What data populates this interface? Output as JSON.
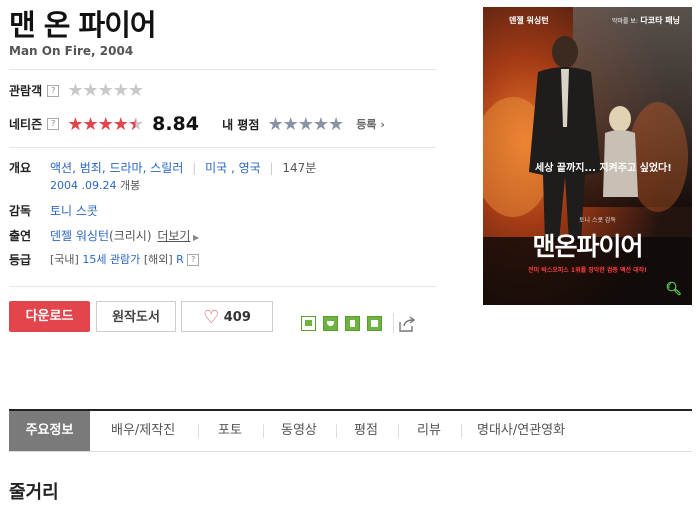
{
  "movie": {
    "title": "맨 온 파이어",
    "original_title": "Man On Fire, 2004"
  },
  "rating": {
    "audience_label": "관람객",
    "netizen_label": "네티즌",
    "netizen_score": "8.84",
    "my_rating_label": "내 평점",
    "register_label": "등록",
    "help_glyph": "?"
  },
  "info": {
    "summary_label": "개요",
    "genres": [
      "액션",
      "범죄",
      "드라마",
      "스릴러"
    ],
    "countries": [
      "미국",
      "영국"
    ],
    "runtime": "147분",
    "release_date": "2004 .09.24",
    "release_suffix": "개봉",
    "director_label": "감독",
    "director": "토니 스콧",
    "cast_label": "출연",
    "cast_name": "덴젤 워싱턴",
    "cast_role": "(크리시)",
    "more_label": "더보기",
    "grade_label": "등급",
    "grade_domestic_prefix": "[국내]",
    "grade_domestic": "15세 관람가",
    "grade_overseas_prefix": "[해외]",
    "grade_overseas": "R"
  },
  "actions": {
    "download_label": "다운로드",
    "book_label": "원작도서",
    "like_count": "409"
  },
  "poster": {
    "actor_left": "덴젤 워싱턴",
    "actor_right_prefix": "악마를 보:",
    "actor_right": "다코타 패닝",
    "tagline": "세상 끝까지... 지켜주고 싶었다!",
    "director_credit": "토니 스콧 감독",
    "title": "맨온파이어",
    "subtitle": "전미 박스오피스 1위를 장악한 검증 액션 대작!"
  },
  "tabs": [
    "주요정보",
    "배우/제작진",
    "포토",
    "동영상",
    "평점",
    "리뷰",
    "명대사/연관영화"
  ],
  "section_title": "줄거리",
  "colors": {
    "accent_red": "#e2454b",
    "link_blue": "#2a67c4",
    "star_red": "#e2454b",
    "star_gray": "#c8c8c8",
    "star_slate": "#8993a4"
  }
}
